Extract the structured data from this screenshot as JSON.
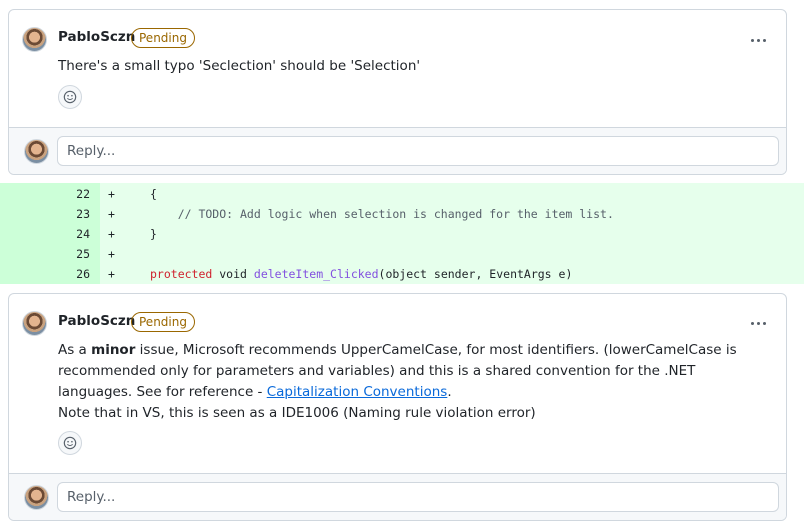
{
  "comments": [
    {
      "username": "PabloSczn",
      "badge": "Pending",
      "text": "There's a small typo 'Seclection' should be 'Selection'",
      "reply_placeholder": "Reply..."
    },
    {
      "username": "PabloSczn",
      "badge": "Pending",
      "text_part1": "As a ",
      "text_bold": "minor",
      "text_part2": " issue, Microsoft recommends UpperCamelCase, for most identifiers. (lowerCamelCase is recommended only for parameters and variables) and this is a shared convention for the .NET languages. See for reference - ",
      "link_text": "Capitalization Conventions",
      "text_part3": ".",
      "text_line2": "Note that in VS, this is seen as a IDE1006 (Naming rule violation error)",
      "reply_placeholder": "Reply..."
    }
  ],
  "diff": {
    "lines": [
      {
        "num": "22",
        "marker": "+",
        "code": "{"
      },
      {
        "num": "23",
        "marker": "+",
        "code": "    // TODO: Add logic when selection is changed for the item list."
      },
      {
        "num": "24",
        "marker": "+",
        "code": "}"
      },
      {
        "num": "25",
        "marker": "+",
        "code": ""
      },
      {
        "num": "26",
        "marker": "+",
        "kw": "protected",
        "kw2": "void",
        "fn": "deleteItem_Clicked",
        "rest": "(object sender, EventArgs e)"
      }
    ]
  },
  "icons": {
    "more": "kebab-horizontal-icon",
    "reaction": "smiley-icon"
  },
  "colors": {
    "pending": "#9a6700",
    "link": "#0969da",
    "diff_add_bg": "#e6ffec",
    "diff_gutter_bg": "#ccffd8"
  }
}
